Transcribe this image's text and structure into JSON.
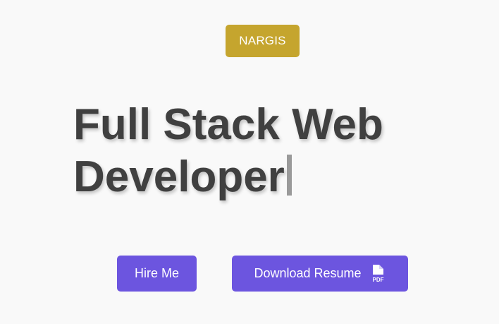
{
  "brand": {
    "name_badge": "NARGIS"
  },
  "hero": {
    "headline_line1": "Full Stack Web",
    "headline_line2": "Developer"
  },
  "actions": {
    "hire_label": "Hire Me",
    "resume_label": "Download Resume",
    "resume_icon": "pdf-file-icon",
    "resume_icon_text": "PDF"
  },
  "colors": {
    "background": "#f9f9f9",
    "badge": "#c5a52e",
    "button": "#6c55df",
    "headline": "#404040",
    "cursor": "#9a9a9a"
  }
}
